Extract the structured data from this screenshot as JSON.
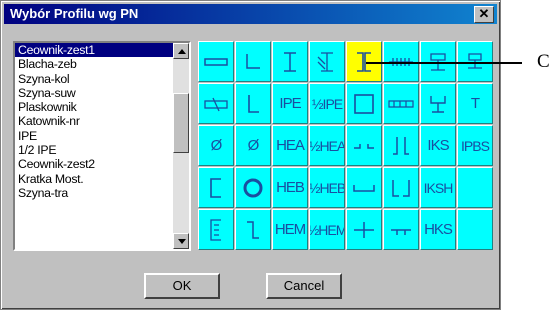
{
  "window": {
    "title": "Wybór Profilu wg PN",
    "close_glyph": "✕"
  },
  "profile_list": {
    "items": [
      "Ceownik-zest1",
      "Blacha-zeb",
      "Szyna-kol",
      "Szyna-suw",
      "Plaskownik",
      "Katownik-nr",
      "IPE",
      "1/2 IPE",
      "Ceownik-zest2",
      "Kratka Most.",
      "Szyna-tra"
    ],
    "selected_index": 0
  },
  "profile_grid": {
    "rows": [
      [
        "rect-icon",
        "angle-l-icon",
        "i-beam-icon",
        "half-i-hatched-icon",
        "double-channel-icon",
        "hatched-strip-icon",
        "tee-cross-icon",
        "tee-cap-icon"
      ],
      [
        "phi-rect-icon",
        "l-profile-icon",
        "IPE",
        "½IPE",
        "box-icon",
        "rail-icon",
        "t-hat-icon",
        "T"
      ],
      [
        "Ø",
        "Ø",
        "HEA",
        "½HEA",
        "rail-top-icon",
        "double-l-icon",
        "IKS",
        "IPBS"
      ],
      [
        "channel-icon",
        "tube-icon",
        "HEB",
        "½HEB",
        "u-trough-icon",
        "l-bracket-icon",
        "IKSH",
        ""
      ],
      [
        "e-channel-icon",
        "plate-l-icon",
        "HEM",
        "½HEM",
        "cross-icon",
        "double-tee-icon",
        "HKS",
        ""
      ]
    ],
    "selected": {
      "row": 0,
      "col": 4
    },
    "cell_color": "#00ffff",
    "selected_color": "#ffff00"
  },
  "annotation": {
    "label": "C"
  },
  "buttons": {
    "ok": "OK",
    "cancel": "Cancel"
  }
}
